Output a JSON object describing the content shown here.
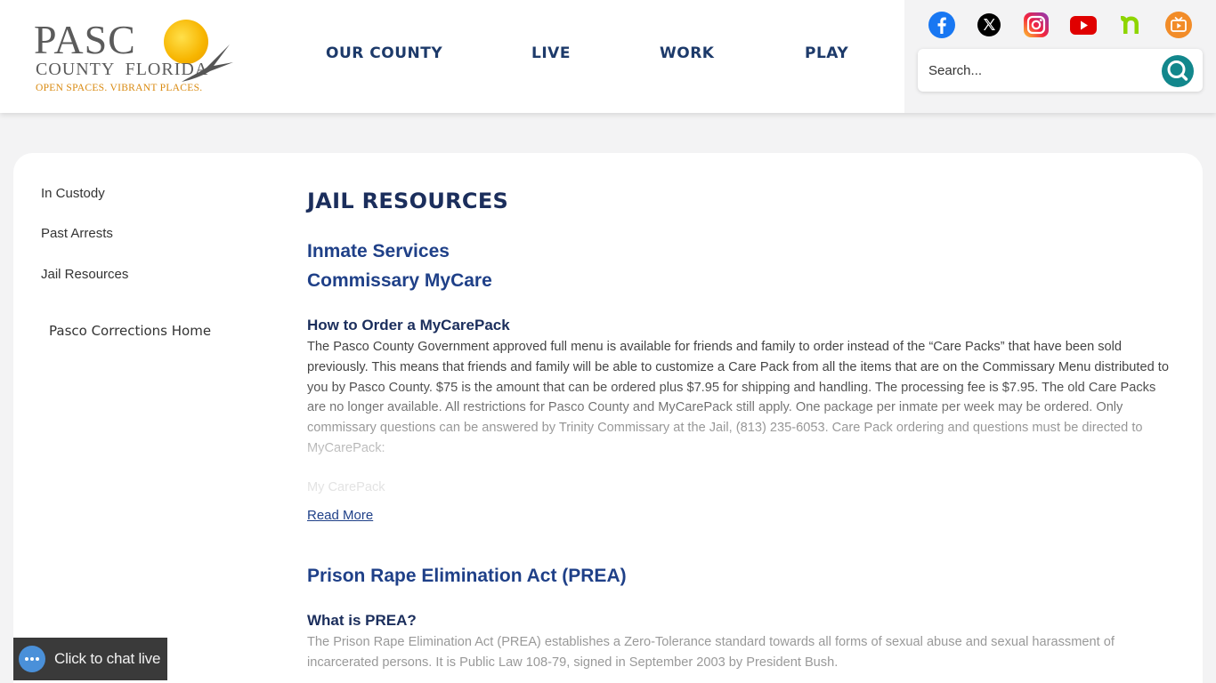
{
  "header": {
    "logo": {
      "main": "PASC",
      "sub": "COUNTY  FLORIDA",
      "tagline": "OPEN SPACES. VIBRANT PLACES."
    },
    "nav": [
      "OUR COUNTY",
      "LIVE",
      "WORK",
      "PLAY"
    ],
    "social": [
      "facebook-icon",
      "x-icon",
      "instagram-icon",
      "youtube-icon",
      "nextdoor-icon",
      "tv-icon"
    ],
    "search": {
      "placeholder": "Search..."
    }
  },
  "sidebar": {
    "items": [
      {
        "label": "In Custody"
      },
      {
        "label": "Past Arrests"
      },
      {
        "label": "Jail Resources"
      }
    ],
    "home_link": "Pasco Corrections Home"
  },
  "main": {
    "title": "JAIL RESOURCES",
    "section1": {
      "heading": "Inmate Services",
      "subheading": "Commissary MyCare",
      "topic": "How to Order a MyCarePack",
      "body": "The Pasco County Government approved full menu is available for friends and family to order instead of the “Care Packs” that have been sold previously. This means that friends and family will be able to customize a Care Pack from all the items that are on the Commissary Menu distributed to you by Pasco County. $75 is the amount that can be ordered plus $7.95 for shipping and handling. The processing fee is $7.95. The old Care Packs are no longer available. All restrictions for Pasco County and MyCarePack still apply. One package per inmate per week may be ordered. Only commissary questions can be answered by Trinity Commissary at the Jail, (813) 235-6053. Care Pack ordering and questions must be directed to MyCarePack:",
      "faded_line": "My CarePack",
      "read_more": "Read More"
    },
    "section2": {
      "heading": "Prison Rape Elimination Act (PREA)",
      "topic": "What is PREA?",
      "body": "The Prison Rape Elimination Act (PREA) establishes a Zero-Tolerance standard towards all forms of sexual abuse and sexual harassment of incarcerated persons. It is Public Law 108-79, signed in September 2003 by President Bush."
    }
  },
  "chat": {
    "label": "Click to chat live"
  },
  "colors": {
    "navy": "#1b2e5c",
    "link_blue": "#1f4088",
    "teal": "#12878c",
    "sun": "#f7b500"
  }
}
